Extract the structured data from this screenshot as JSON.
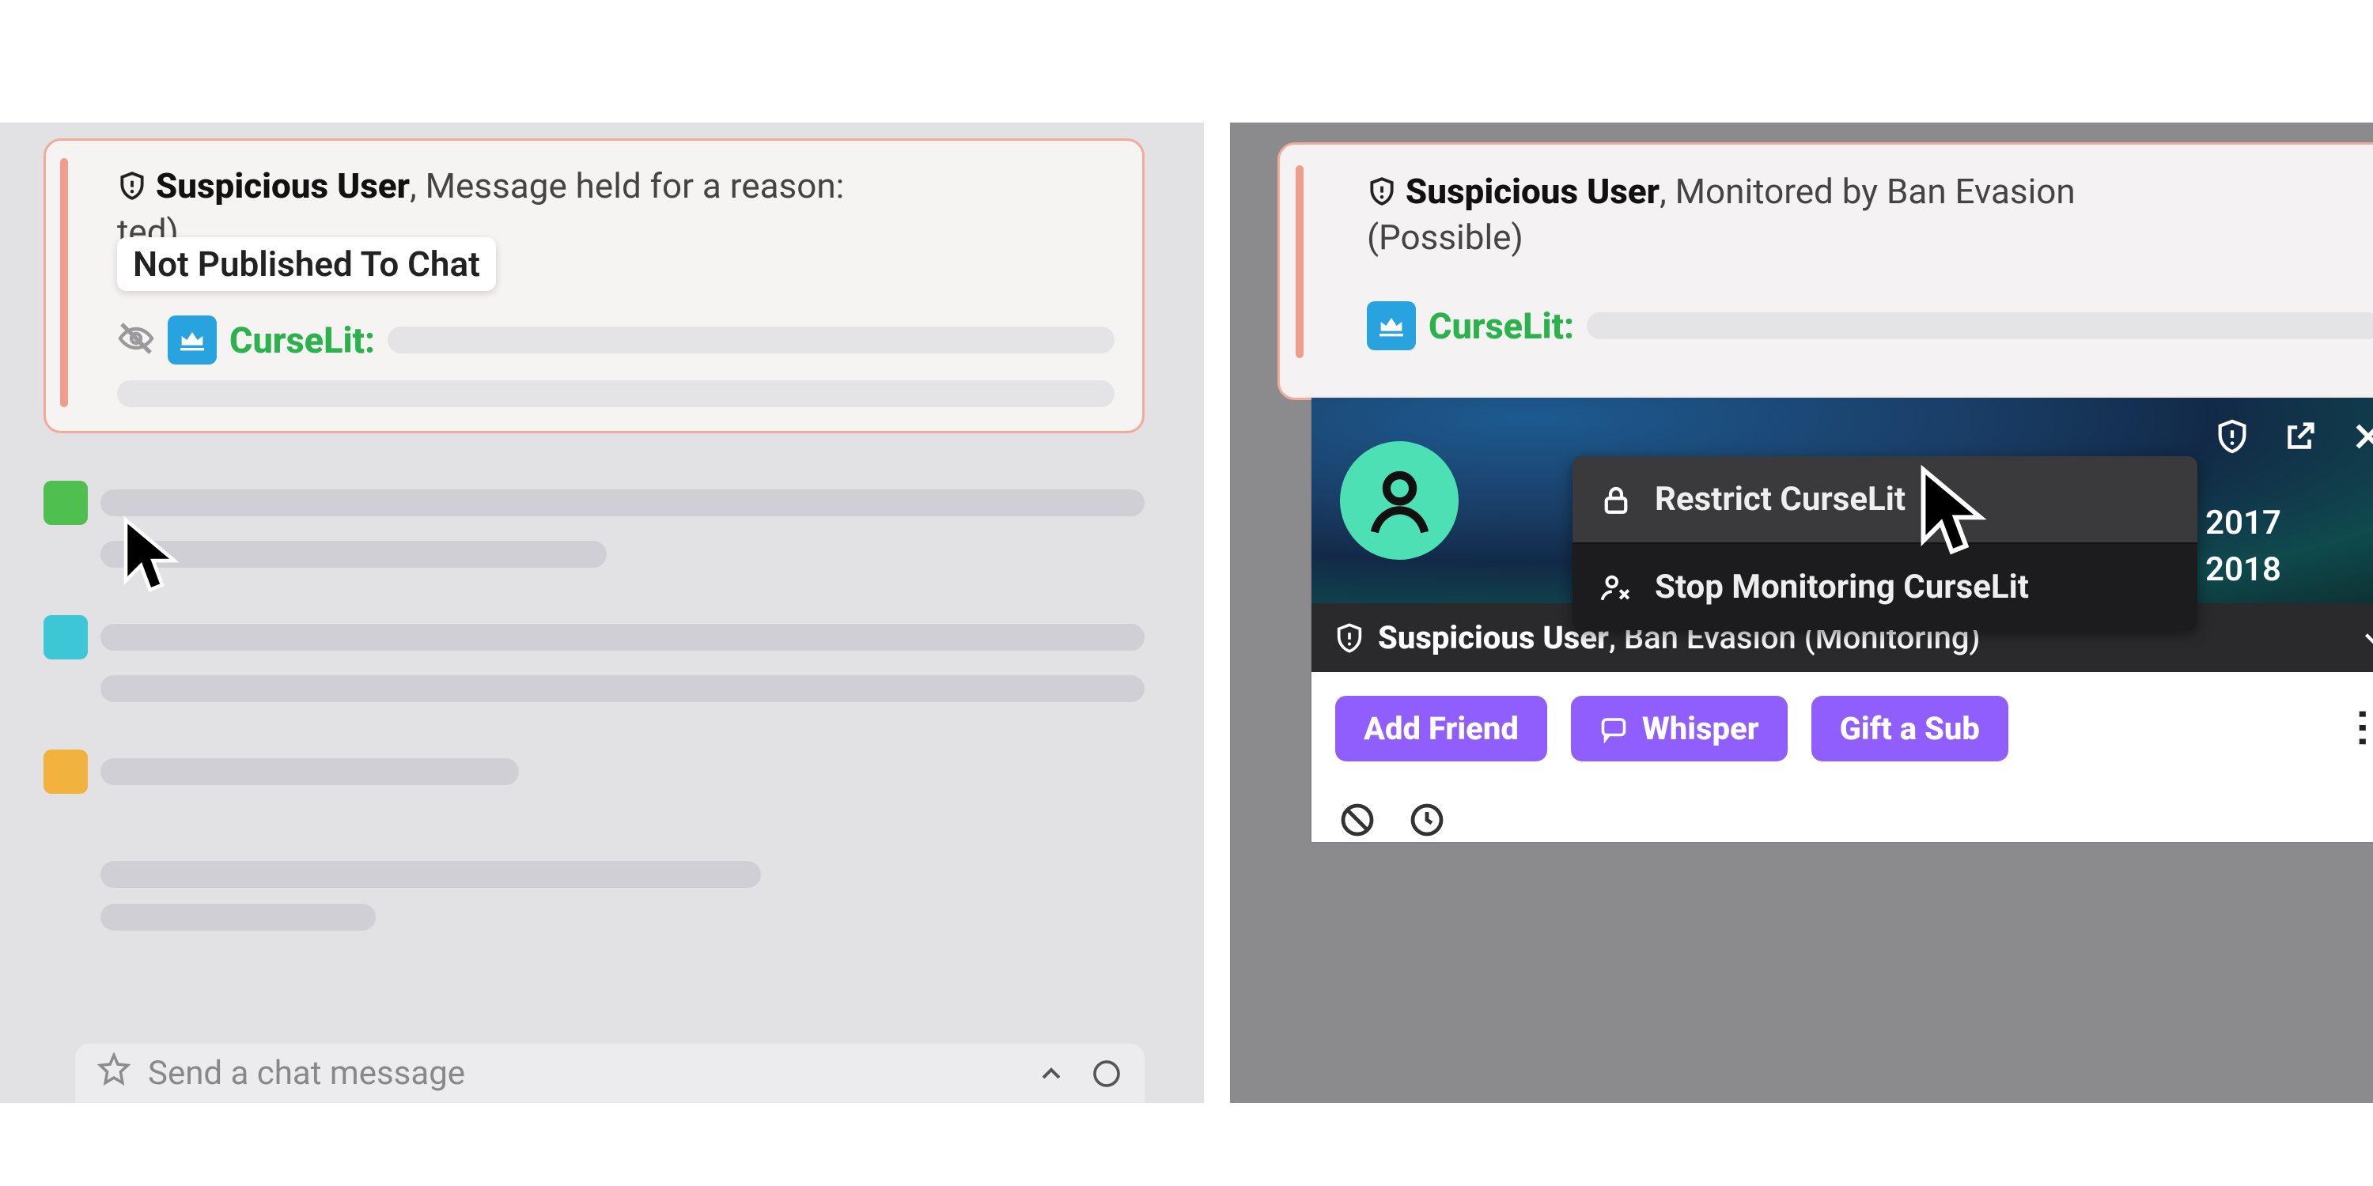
{
  "left": {
    "flag": {
      "title_bold": "Suspicious User",
      "title_rest": ", Message held for a reason:",
      "sub_partial": "ted)",
      "tooltip": "Not Published To Chat",
      "username": "CurseLit:"
    },
    "compose_placeholder": "Send a chat message"
  },
  "right": {
    "flag": {
      "title_bold": "Suspicious User",
      "title_rest": ", Monitored by Ban Evasion",
      "sub": "(Possible)",
      "username": "CurseLit:"
    },
    "usercard": {
      "menu": {
        "restrict": "Restrict CurseLit",
        "stop": "Stop Monitoring CurseLit"
      },
      "years": {
        "a": "2017",
        "b": "2018"
      },
      "status_bold": "Suspicious User",
      "status_rest": ", Ban Evasion (Monitoring)",
      "actions": {
        "add_friend": "Add Friend",
        "whisper": "Whisper",
        "gift": "Gift a Sub"
      }
    }
  }
}
